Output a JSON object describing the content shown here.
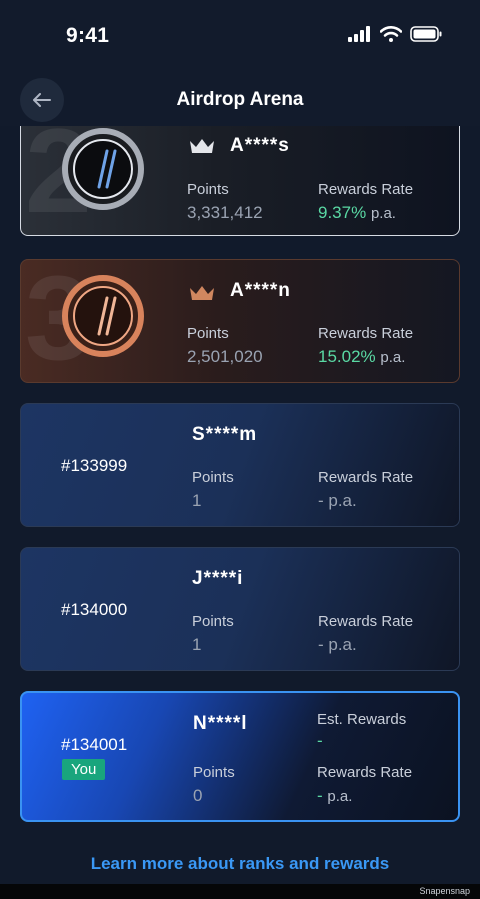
{
  "status": {
    "time": "9:41"
  },
  "header": {
    "title": "Airdrop Arena"
  },
  "cards": [
    {
      "rank_badge": "2",
      "name": "A****s",
      "points_label": "Points",
      "points": "3,331,412",
      "rate_label": "Rewards Rate",
      "rate": "9.37%",
      "pa": "p.a."
    },
    {
      "rank_badge": "3",
      "name": "A****n",
      "points_label": "Points",
      "points": "2,501,020",
      "rate_label": "Rewards Rate",
      "rate": "15.02%",
      "pa": "p.a."
    },
    {
      "rank": "#133999",
      "name": "S****m",
      "points_label": "Points",
      "points": "1",
      "rate_label": "Rewards Rate",
      "rate": "- p.a."
    },
    {
      "rank": "#134000",
      "name": "J****i",
      "points_label": "Points",
      "points": "1",
      "rate_label": "Rewards Rate",
      "rate": "- p.a."
    },
    {
      "rank": "#134001",
      "you": "You",
      "name": "N****l",
      "est_label": "Est. Rewards",
      "est": "-",
      "points_label": "Points",
      "points": "0",
      "rate_label": "Rewards Rate",
      "rate": "-",
      "pa": "p.a."
    }
  ],
  "link": {
    "learn_more": "Learn more about ranks and rewards"
  },
  "footer": {
    "brand": "Snapensnap"
  },
  "colors": {
    "accent": "#3a98f5",
    "green": "#5ad9a4",
    "badge": "#19a57d"
  }
}
